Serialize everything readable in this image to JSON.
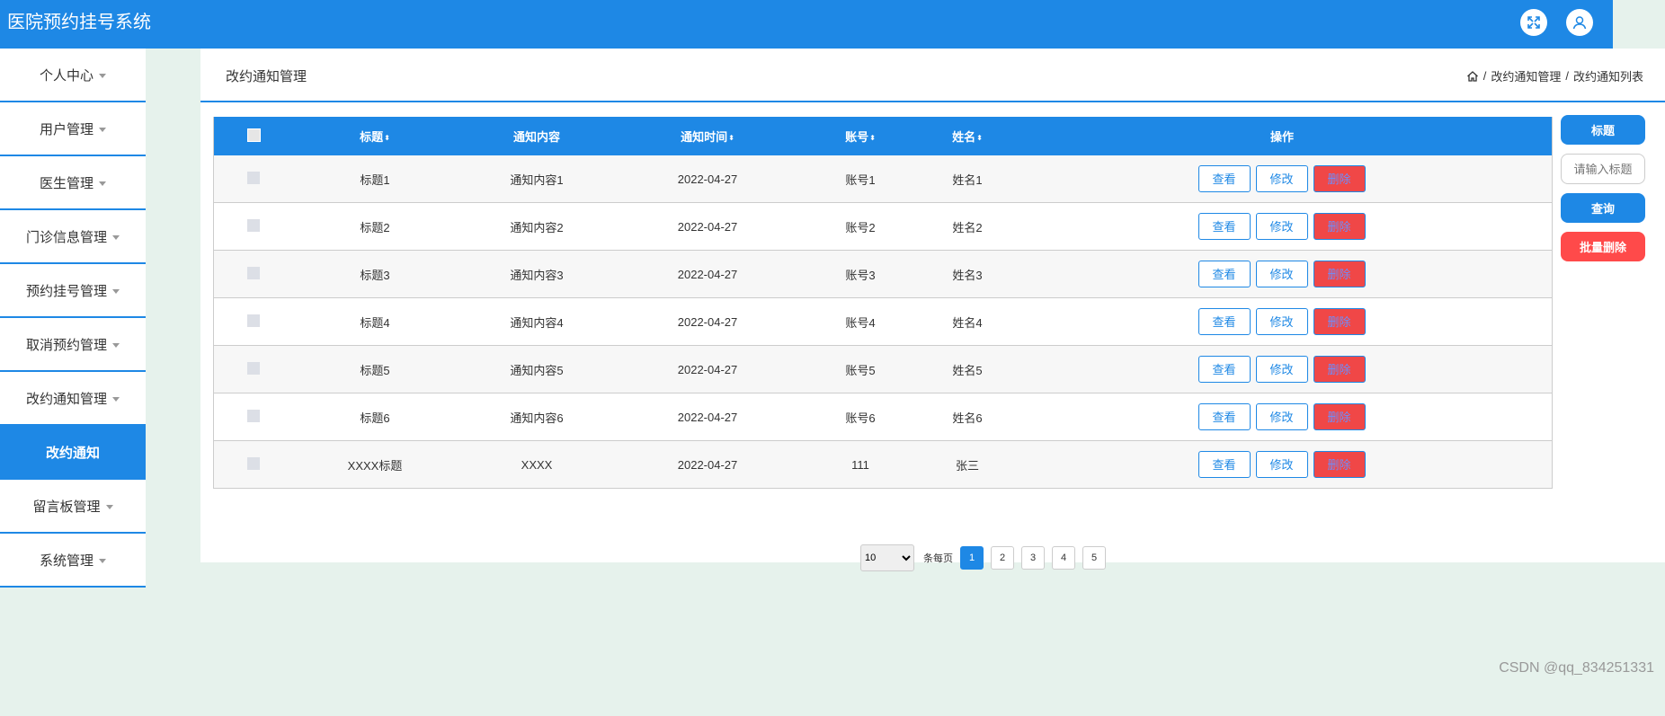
{
  "header": {
    "title": "医院预约挂号系统"
  },
  "sidebar": {
    "items": [
      {
        "label": "个人中心",
        "caret": true,
        "active": false
      },
      {
        "label": "用户管理",
        "caret": true,
        "active": false
      },
      {
        "label": "医生管理",
        "caret": true,
        "active": false
      },
      {
        "label": "门诊信息管理",
        "caret": true,
        "active": false
      },
      {
        "label": "预约挂号管理",
        "caret": true,
        "active": false
      },
      {
        "label": "取消预约管理",
        "caret": true,
        "active": false
      },
      {
        "label": "改约通知管理",
        "caret": true,
        "active": false
      },
      {
        "label": "改约通知",
        "caret": false,
        "active": true
      },
      {
        "label": "留言板管理",
        "caret": true,
        "active": false
      },
      {
        "label": "系统管理",
        "caret": true,
        "active": false
      }
    ]
  },
  "page": {
    "title": "改约通知管理",
    "breadcrumb": [
      "改约通知管理",
      "改约通知列表"
    ]
  },
  "table": {
    "headers": {
      "title": "标题",
      "content": "通知内容",
      "time": "通知时间",
      "account": "账号",
      "name": "姓名",
      "actions": "操作"
    },
    "actions": {
      "view": "查看",
      "edit": "修改",
      "delete": "删除"
    },
    "rows": [
      {
        "title": "标题1",
        "content": "通知内容1",
        "time": "2022-04-27",
        "account": "账号1",
        "name": "姓名1"
      },
      {
        "title": "标题2",
        "content": "通知内容2",
        "time": "2022-04-27",
        "account": "账号2",
        "name": "姓名2"
      },
      {
        "title": "标题3",
        "content": "通知内容3",
        "time": "2022-04-27",
        "account": "账号3",
        "name": "姓名3"
      },
      {
        "title": "标题4",
        "content": "通知内容4",
        "time": "2022-04-27",
        "account": "账号4",
        "name": "姓名4"
      },
      {
        "title": "标题5",
        "content": "通知内容5",
        "time": "2022-04-27",
        "account": "账号5",
        "name": "姓名5"
      },
      {
        "title": "标题6",
        "content": "通知内容6",
        "time": "2022-04-27",
        "account": "账号6",
        "name": "姓名6"
      },
      {
        "title": "XXXX标题",
        "content": "XXXX",
        "time": "2022-04-27",
        "account": "111",
        "name": "张三"
      }
    ]
  },
  "search": {
    "title_label": "标题",
    "placeholder": "请输入标题",
    "query_label": "查询",
    "batch_delete_label": "批量删除"
  },
  "pagination": {
    "page_size": "10",
    "per_page_label": "条每页",
    "pages": [
      "1",
      "2",
      "3",
      "4",
      "5"
    ],
    "current": "1"
  },
  "watermark": "CSDN @qq_834251331",
  "colors": {
    "primary": "#1e88e5",
    "danger": "#ff4a4a",
    "background": "#e6f2ec"
  }
}
